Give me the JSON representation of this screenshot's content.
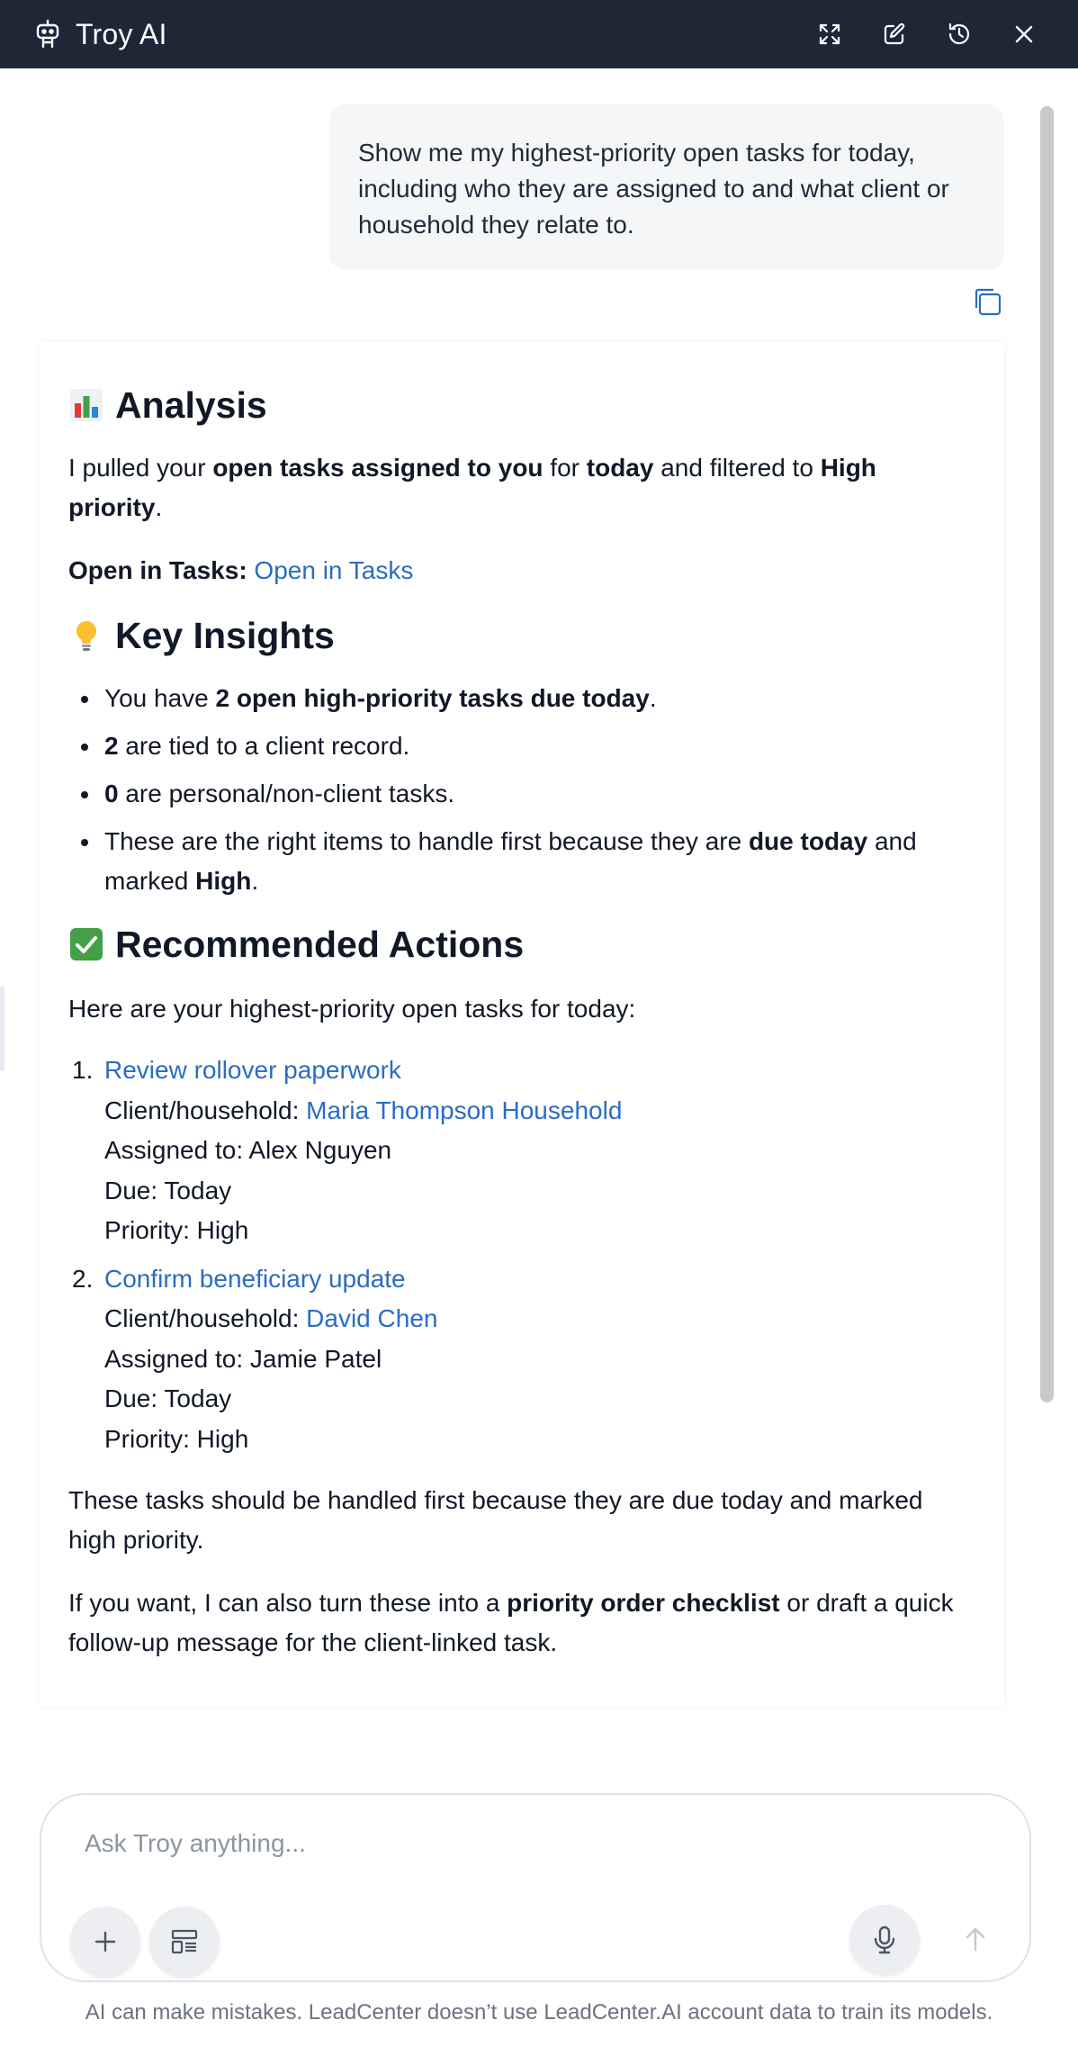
{
  "header": {
    "title": "Troy AI",
    "logo_icon": "robot-icon",
    "actions": [
      {
        "icon": "expand-icon",
        "name": "expand-button"
      },
      {
        "icon": "edit-icon",
        "name": "new-chat-button"
      },
      {
        "icon": "history-icon",
        "name": "history-button"
      },
      {
        "icon": "close-icon",
        "name": "close-button"
      }
    ],
    "background_color": "#1d2735"
  },
  "conversation": {
    "user_message": "Show me my highest-priority open tasks for today, including who they are assigned to and what client or household they relate to.",
    "copy_icon": "copy-icon",
    "response": {
      "analysis": {
        "heading": "Analysis",
        "emoji": "chart-emoji",
        "pulled_text_1": "I pulled your ",
        "pulled_bold_1": "open tasks assigned to you",
        "pulled_text_2": " for ",
        "pulled_bold_2": "today",
        "pulled_text_3": " and filtered to ",
        "pulled_bold_3": "High priority",
        "pulled_text_4": ".",
        "open_label": "Open in Tasks:",
        "open_link": "Open in Tasks"
      },
      "insights": {
        "heading": "Key Insights",
        "emoji": "lightbulb-emoji",
        "item1_a": "You have ",
        "item1_b": "2 open high-priority tasks due today",
        "item1_c": ".",
        "item2_a": "2",
        "item2_b": " are tied to a client record.",
        "item3_a": "0",
        "item3_b": " are personal/non-client tasks.",
        "item4_a": "These are the right items to handle first because they are ",
        "item4_b": "due today",
        "item4_c": " and marked ",
        "item4_d": "High",
        "item4_e": "."
      },
      "actions": {
        "heading": "Recommended Actions",
        "emoji": "check-emoji",
        "intro": "Here are your highest-priority open tasks for today:",
        "tasks": [
          {
            "number": "1.",
            "title": "Review rollover paperwork",
            "client_label": "Client/household: ",
            "client": "Maria Thompson Household",
            "assigned": "Assigned to: Alex Nguyen",
            "due": "Due: Today",
            "priority": "Priority: High"
          },
          {
            "number": "2.",
            "title": "Confirm beneficiary update",
            "client_label": "Client/household: ",
            "client": "David Chen",
            "assigned": "Assigned to: Jamie Patel",
            "due": "Due: Today",
            "priority": "Priority: High"
          }
        ],
        "closing": "These tasks should be handled first because they are due today and marked high priority.",
        "offer_a": "If you want, I can also turn these into a ",
        "offer_b": "priority order checklist",
        "offer_c": " or draft a quick follow-up message for the client-linked task."
      }
    }
  },
  "composer": {
    "placeholder": "Ask Troy anything...",
    "value": "",
    "buttons": [
      {
        "icon": "plus-icon",
        "name": "attach-button"
      },
      {
        "icon": "template-icon",
        "name": "templates-button"
      },
      {
        "icon": "microphone-icon",
        "name": "voice-button"
      },
      {
        "icon": "arrow-up-icon",
        "name": "send-button"
      }
    ]
  },
  "footer": {
    "disclaimer": "AI can make mistakes. LeadCenter doesn’t use LeadCenter.AI account data to train its models."
  },
  "colors": {
    "link": "#2b6cc4",
    "bubble": "#f5f6f8",
    "text": "#111827"
  }
}
